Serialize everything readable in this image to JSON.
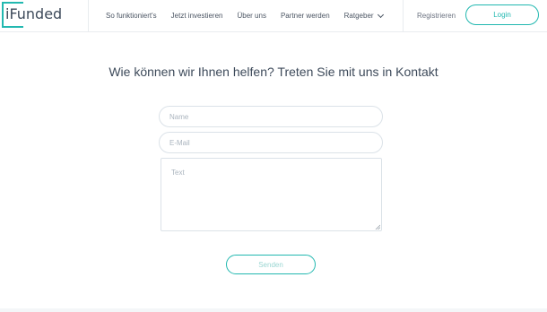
{
  "header": {
    "logo_text": "iFunded",
    "nav": [
      {
        "label": "So funktioniert's"
      },
      {
        "label": "Jetzt investieren"
      },
      {
        "label": "Über uns"
      },
      {
        "label": "Partner werden"
      },
      {
        "label": "Ratgeber"
      }
    ],
    "register_label": "Registrieren",
    "login_label": "Login"
  },
  "contact": {
    "title": "Wie können wir Ihnen helfen? Treten Sie mit uns in Kontakt",
    "name_placeholder": "Name",
    "email_placeholder": "E-Mail",
    "text_placeholder": "Text",
    "send_label": "Senden"
  },
  "colors": {
    "accent": "#22b8b0",
    "text": "#3d4a5a",
    "border": "#dbe2e8"
  }
}
